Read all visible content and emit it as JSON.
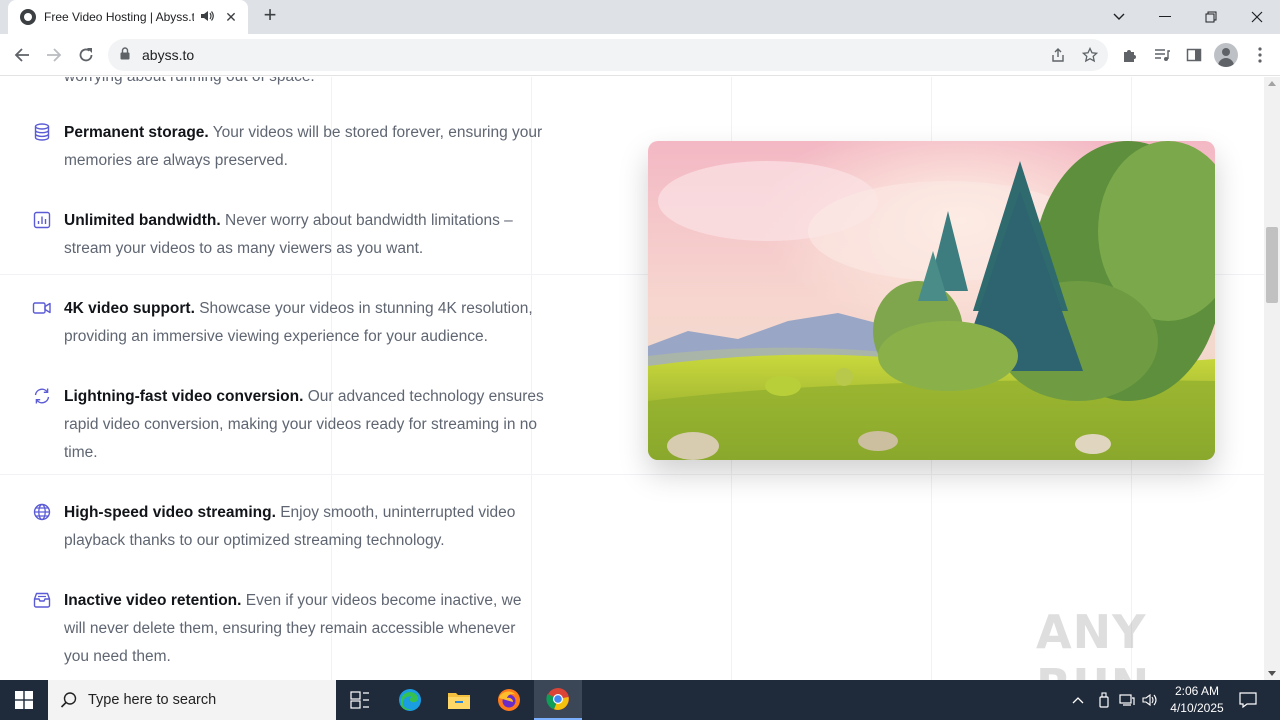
{
  "browser": {
    "tab": {
      "title": "Free Video Hosting | Abyss.t",
      "favicon": "abyss-favicon",
      "audio_icon": "speaker-icon",
      "close_icon": "close-icon"
    },
    "new_tab_icon": "plus-icon",
    "window_controls": {
      "tab_search_icon": "chevron-down-icon",
      "minimize_icon": "minimize-icon",
      "restore_icon": "restore-icon",
      "close_icon": "close-icon"
    },
    "toolbar": {
      "back_icon": "back-arrow-icon",
      "forward_icon": "forward-arrow-icon",
      "reload_icon": "reload-icon",
      "url": "abyss.to",
      "share_icon": "share-icon",
      "bookmark_icon": "star-icon",
      "extensions_icon": "puzzle-icon",
      "media_icon": "media-control-icon",
      "sidepanel_icon": "side-panel-icon",
      "profile_icon": "profile-avatar-icon",
      "menu_icon": "kebab-menu-icon"
    }
  },
  "page": {
    "cutoff_text": "worrying about running out of space.",
    "features": [
      {
        "icon": "database-icon",
        "title": "Permanent storage.",
        "text": " Your videos will be stored forever, ensuring your memories are always preserved."
      },
      {
        "icon": "bar-chart-icon",
        "title": "Unlimited bandwidth.",
        "text": " Never worry about bandwidth limitations – stream your videos to as many viewers as you want."
      },
      {
        "icon": "video-camera-icon",
        "title": "4K video support.",
        "text": " Showcase your videos in stunning 4K resolution, providing an immersive viewing experience for your audience."
      },
      {
        "icon": "refresh-icon",
        "title": "Lightning-fast video conversion.",
        "text": " Our advanced technology ensures rapid video conversion, making your videos ready for streaming in no time."
      },
      {
        "icon": "globe-icon",
        "title": "High-speed video streaming.",
        "text": " Enjoy smooth, uninterrupted video playback thanks to our optimized streaming technology."
      },
      {
        "icon": "archive-box-icon",
        "title": "Inactive video retention.",
        "text": " Even if your videos become inactive, we will never delete them, ensuring they remain accessible whenever you need them."
      }
    ],
    "hero_image": "landscape-illustration",
    "watermark": "ANY RUN"
  },
  "taskbar": {
    "start_icon": "windows-logo-icon",
    "search_placeholder": "Type here to search",
    "apps": [
      "task-view-icon",
      "edge-icon",
      "file-explorer-icon",
      "firefox-icon",
      "chrome-icon"
    ],
    "tray": [
      "chevron-up-icon",
      "usb-icon",
      "network-icon",
      "volume-icon"
    ],
    "time": "2:06 AM",
    "date": "4/10/2025",
    "notifications_icon": "notification-icon"
  },
  "colors": {
    "accent_icon": "#5b5bd6",
    "taskbar": "#1f2a3a",
    "tabstrip": "#dee1e6"
  }
}
